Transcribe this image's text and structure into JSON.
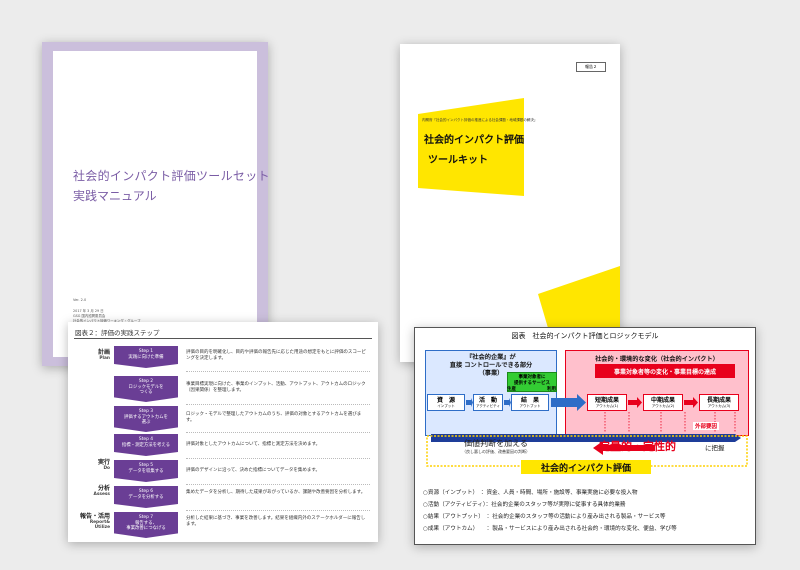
{
  "doc1": {
    "title_line1": "社会的インパクト評価ツールセット",
    "title_line2": "実践マニュアル",
    "version": "Ver. 2.0",
    "meta": [
      "2017 年 3 月 29 日",
      "GSG 国内諮問委員会",
      "社会的インパクト評価ワーキング・グループ"
    ]
  },
  "doc2": {
    "badge": "報告２",
    "header": "内閣府「社会的インパクト評価の推進による社会課題・地域課題の解決」",
    "title_line1": "社会的インパクト評価",
    "title_line2": "ツールキット",
    "colors": {
      "accent": "#ffe600"
    }
  },
  "doc3": {
    "caption": "図表２：評価の実践ステップ",
    "sections": [
      {
        "ja": "計画",
        "en": "Plan"
      },
      {
        "ja": "実行",
        "en": "Do"
      },
      {
        "ja": "分析",
        "en": "Assess"
      },
      {
        "ja": "報告・活用",
        "en": "Report&\nUtilize"
      }
    ],
    "steps": [
      {
        "num": "Step 1",
        "label": "実践に向けた準備",
        "desc": "評価の目的を明確化し、目的や評価の報告先に応じた用途の想定をもとに評価のスコーピングを決定します。"
      },
      {
        "num": "Step 2",
        "label": "ロジックモデルを\nつくる",
        "desc": "事業目標実現に向けた、事業のインプット、活動、アウトプット、アウトカムのロジック（因果関係）を整理します。"
      },
      {
        "num": "Step 3",
        "label": "評価するアウトカムを\n選ぶ",
        "desc": "ロジック・モデルで整理したアウトカムのうち、評価の対象とするアウトカムを選びます。"
      },
      {
        "num": "Step 4",
        "label": "指標・測定方法を考える",
        "desc": "評価対象としたアウトカムについて、指標と測定方法を決めます。"
      },
      {
        "num": "Step 5",
        "label": "データを収集する",
        "desc": "評価のデザインに沿って、決めた指標についてデータを集めます。"
      },
      {
        "num": "Step 6",
        "label": "データを分析する",
        "desc": "集めたデータを分析し、期待した成果があがっているか、課題や改善要因を分析します。"
      },
      {
        "num": "Step 7",
        "label": "報告する、\n事業改善につなげる",
        "desc": "分析した結果に基づき、事業を改善します。結果を組織内外のステークホルダーに報告します。"
      }
    ],
    "colors": {
      "step": "#6a3e95"
    }
  },
  "doc4": {
    "title": "図表　社会的インパクト評価とロジックモデル",
    "left_box_title": "『社会的企業』が\n直接 コントロールできる部分\n（事業）",
    "green_box": "事業対象者に\n提供するサービス",
    "green_sub": [
      "生産",
      "利用"
    ],
    "right_box_title": "社会的・環境的な変化（社会的インパクト）",
    "red_banner": "事業対象者等の変化・事業目標の達成",
    "chain": [
      {
        "label": "資　源",
        "sub": "インプット"
      },
      {
        "label": "活　動",
        "sub": "アクティビティ"
      },
      {
        "label": "結　果",
        "sub": "アウトプット"
      },
      {
        "label": "短期成果",
        "sub": "アウトカム(1)"
      },
      {
        "label": "中期成果",
        "sub": "アウトカム(2)"
      },
      {
        "label": "長期成果",
        "sub": "アウトカム(3)"
      }
    ],
    "external": "外部要因",
    "value_judgement": "価値判断を加える",
    "value_sub": "（良し悪しの評価、改善要因の判断）",
    "quant_qual": "定量的・定性的",
    "grasp": "に把握",
    "footer_title": "社会的インパクト評価",
    "legend": [
      "○資源（インプット）　：資金、人員・時間、場所・施設等、事業実施に必要な投入物",
      "○活動（アクティビティ）：社会的企業のスタッフ等が実際に従事する具体的業務",
      "○結果（アウトプット）　：社会的企業のスタッフ等の活動により産み出される製品・サービス等",
      "○成果（アウトカム）　　：製品・サービスにより産み出される社会的・環境的な変化、便益、学び等"
    ],
    "colors": {
      "blue": "#2e6dc7",
      "pink": "#ffc0cc",
      "red": "#e8001c",
      "green": "#33cc33",
      "yellow": "#ffe600"
    }
  }
}
